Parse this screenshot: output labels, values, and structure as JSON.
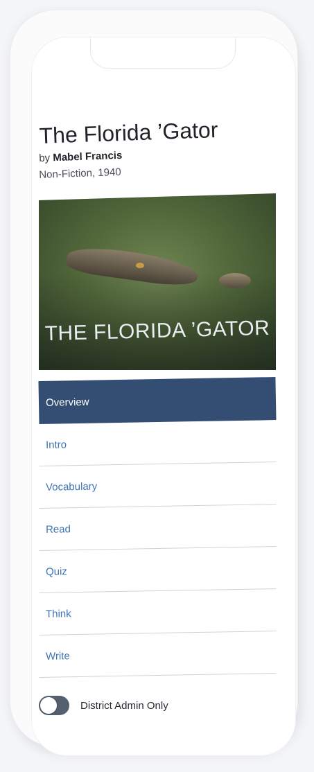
{
  "book": {
    "title": "The Florida ’Gator",
    "by_prefix": "by",
    "author": "Mabel Francis",
    "meta": "Non-Fiction, 1940",
    "cover_title": "THE FLORIDA ’GATOR"
  },
  "menu": {
    "items": [
      {
        "label": "Overview"
      },
      {
        "label": "Intro"
      },
      {
        "label": "Vocabulary"
      },
      {
        "label": "Read"
      },
      {
        "label": "Quiz"
      },
      {
        "label": "Think"
      },
      {
        "label": "Write"
      }
    ]
  },
  "toggle": {
    "label": "District Admin Only"
  },
  "colors": {
    "accent": "#3e74b6",
    "active_bg": "#334d73",
    "toggle_bg": "#55606e"
  }
}
